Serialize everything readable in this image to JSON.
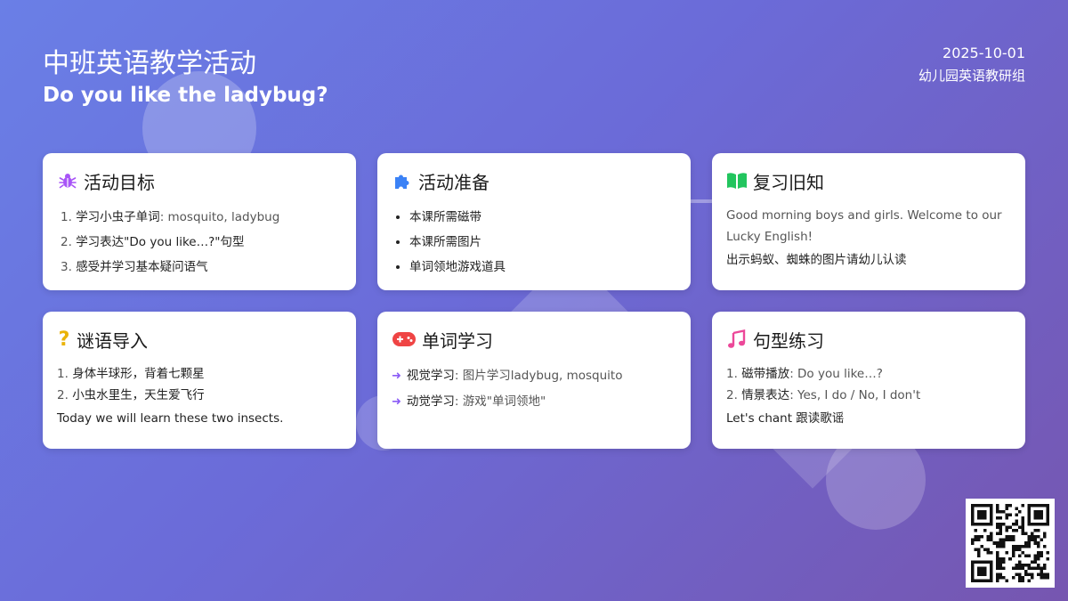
{
  "header": {
    "title": "中班英语教学活动",
    "subtitle": "Do you like the ladybug?",
    "date": "2025-10-01",
    "organization": "幼儿园英语教研组"
  },
  "cards": {
    "goals": {
      "icon": "bug-icon",
      "title": "活动目标",
      "items": [
        {
          "num": "1.",
          "cn": "学习小虫子单词",
          "en": ": mosquito, ladybug"
        },
        {
          "num": "2.",
          "cn": "学习表达\"Do you like…?\"句型",
          "en": ""
        },
        {
          "num": "3.",
          "cn": "感受并学习基本疑问语气",
          "en": ""
        }
      ]
    },
    "preparation": {
      "icon": "puzzle-icon",
      "title": "活动准备",
      "items": [
        "本课所需磁带",
        "本课所需图片",
        "单词领地游戏道具"
      ]
    },
    "review": {
      "icon": "book-icon",
      "title": "复习旧知",
      "paragraph": "Good morning boys and girls. Welcome to our Lucky English!",
      "line": "出示蚂蚁、蜘蛛的图片请幼儿认读"
    },
    "riddle": {
      "icon": "question-icon",
      "title": "谜语导入",
      "items": [
        {
          "num": "1.",
          "text": "身体半球形，背着七颗星"
        },
        {
          "num": "2.",
          "text": "小虫水里生，天生爱飞行"
        }
      ],
      "note": "Today we will learn these two insects."
    },
    "words": {
      "icon": "gamepad-icon",
      "title": "单词学习",
      "items": [
        {
          "cn": "视觉学习",
          "en": ": 图片学习ladybug, mosquito"
        },
        {
          "cn": "动觉学习",
          "en": ": 游戏\"单词领地\""
        }
      ]
    },
    "pattern": {
      "icon": "music-icon",
      "title": "句型练习",
      "items": [
        {
          "num": "1.",
          "cn": "磁带播放",
          "en": ": Do you like…?"
        },
        {
          "num": "2.",
          "cn": "情景表达",
          "en": ": Yes, I do / No, I don't"
        }
      ],
      "note": "Let's chant 跟读歌谣"
    }
  },
  "colors": {
    "bug": "#a855f7",
    "puzzle": "#3b82f6",
    "book": "#22c55e",
    "question": "#eab308",
    "gamepad": "#ef4444",
    "music": "#ec4899"
  }
}
